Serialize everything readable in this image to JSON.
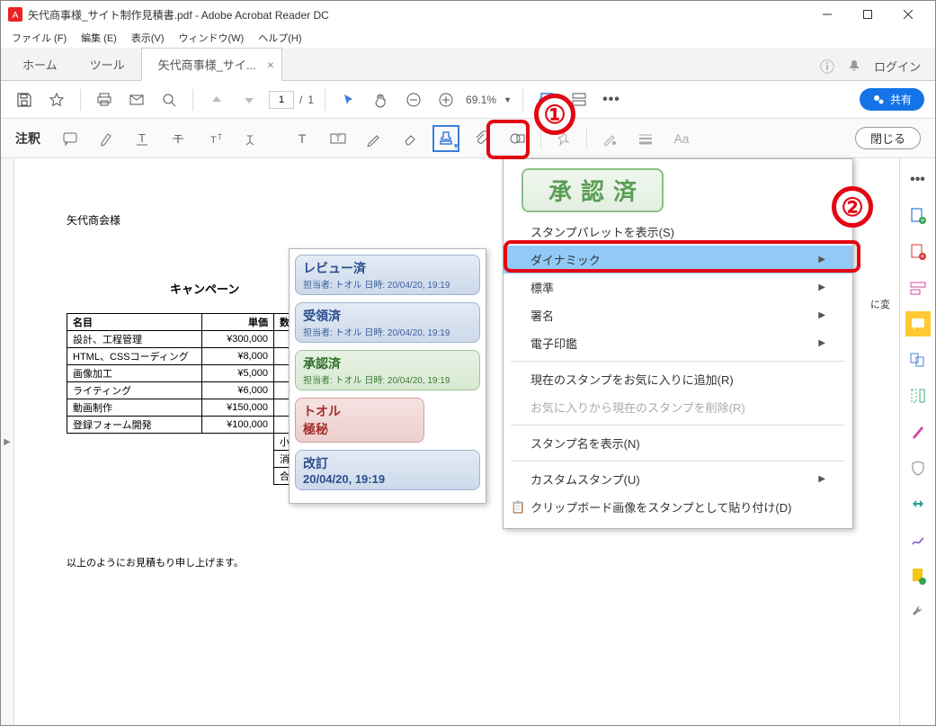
{
  "titlebar": {
    "title": "矢代商事様_サイト制作見積書.pdf - Adobe Acrobat Reader DC"
  },
  "menubar": {
    "file": "ファイル (F)",
    "edit": "編集 (E)",
    "view": "表示(V)",
    "window": "ウィンドウ(W)",
    "help": "ヘルプ(H)"
  },
  "tabs": {
    "home": "ホーム",
    "tools": "ツール",
    "doc": "矢代商事様_サイ...",
    "login": "ログイン"
  },
  "toolbar": {
    "page_current": "1",
    "page_total": "1",
    "zoom": "69.1%",
    "share": "共有"
  },
  "commentbar": {
    "label": "注釈",
    "close": "閉じる"
  },
  "doc": {
    "addressee": "矢代商会様",
    "campaign": "キャンペーン",
    "table_headers": {
      "name": "名目",
      "price": "単価",
      "qty": "数"
    },
    "rows": [
      {
        "name": "設計、工程管理",
        "price": "¥300,000"
      },
      {
        "name": "HTML、CSSコーディング",
        "price": "¥8,000"
      },
      {
        "name": "画像加工",
        "price": "¥5,000"
      },
      {
        "name": "ライティング",
        "price": "¥6,000"
      },
      {
        "name": "動画制作",
        "price": "¥150,000"
      },
      {
        "name": "登録フォーム開発",
        "price": "¥100,000"
      }
    ],
    "subtotal_label": "小",
    "tax_label": "消",
    "total_label": "合",
    "note": "以上のようにお見積もり申し上げます。",
    "partial_text": "に変"
  },
  "approved_stamp": "承認済",
  "dynamic_stamps": [
    {
      "title": "レビュー済",
      "sub": "担当者: トオル 日時: 20/04/20, 19:19",
      "cls": "st-blue"
    },
    {
      "title": "受領済",
      "sub": "担当者: トオル 日時: 20/04/20, 19:19",
      "cls": "st-blue"
    },
    {
      "title": "承認済",
      "sub": "担当者: トオル 日時: 20/04/20, 19:19",
      "cls": "st-green"
    },
    {
      "title": "トオル",
      "sub": "極秘",
      "cls": "st-red",
      "big": true
    },
    {
      "title": "改訂",
      "sub": "20/04/20, 19:19",
      "cls": "st-blue",
      "big": true
    }
  ],
  "stamp_menu": {
    "palette": "スタンプパレットを表示(S)",
    "dynamic": "ダイナミック",
    "standard": "標準",
    "signature": "署名",
    "seal": "電子印鑑",
    "fav_add": "現在のスタンプをお気に入りに追加(R)",
    "fav_del": "お気に入りから現在のスタンプを削除(R)",
    "show_name": "スタンプ名を表示(N)",
    "custom": "カスタムスタンプ(U)",
    "clipboard": "クリップボード画像をスタンプとして貼り付け(D)"
  },
  "callouts": {
    "one": "①",
    "two": "②"
  }
}
